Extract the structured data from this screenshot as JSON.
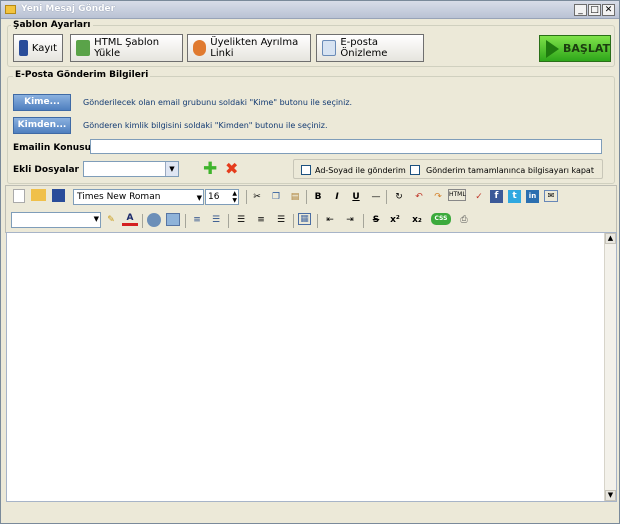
{
  "window": {
    "title": "Yeni Mesaj Gönder",
    "controls": {
      "minimize": "_",
      "maximize": "□",
      "close": "✕"
    }
  },
  "template_group": {
    "title": "Şablon Ayarları",
    "buttons": {
      "save": "Kayıt",
      "html_template": "HTML Şablon Yükle",
      "unsubscribe": "Üyelikten Ayrılma Linki",
      "preview": "E-posta Önizleme",
      "start": "BAŞLAT"
    }
  },
  "send_group": {
    "title": "E-Posta Gönderim Bilgileri",
    "to_button": "Kime...",
    "to_hint": "Gönderilecek olan email grubunu soldaki \"Kime\" butonu ile seçiniz.",
    "from_button": "Kimden...",
    "from_hint": "Gönderen kimlik bilgisini soldaki \"Kimden\" butonu ile seçiniz.",
    "subject_label": "Emailin Konusu",
    "subject_value": "",
    "attachments_label": "Ekli Dosyalar",
    "attachments_value": "",
    "check_fullname": "Ad-Soyad ile gönderim",
    "check_shutdown": "Gönderim tamamlanınca bilgisayarı kapat"
  },
  "editor": {
    "font_name": "Times New Roman",
    "font_size": "16",
    "style_value": "",
    "content": ""
  }
}
